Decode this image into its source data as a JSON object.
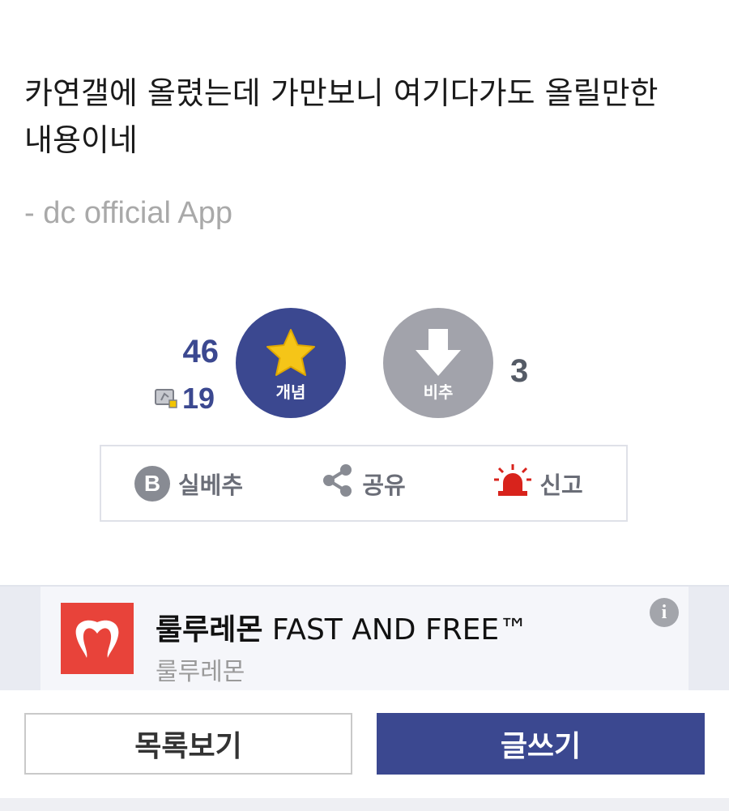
{
  "post": {
    "text_line1": "카연갤에 올렸는데 가만보니 여기다가도 올릴만한",
    "text_line2": "내용이네",
    "signature": "- dc official App"
  },
  "recommend": {
    "up_count": "46",
    "fixed_count": "19",
    "up_label": "개념",
    "down_label": "비추",
    "down_count": "3"
  },
  "actions": {
    "real_best_label": "실베추",
    "real_best_icon_letter": "B",
    "share_label": "공유",
    "report_label": "신고"
  },
  "ad": {
    "brand_bold": "룰루레몬",
    "headline": " FAST AND FREE™",
    "advertiser": "룰루레몬",
    "info_icon": "i"
  },
  "bottom": {
    "list_label": "목록보기",
    "write_label": "글쓰기"
  },
  "colors": {
    "primary": "#3b4890",
    "downvote": "#a2a3ab",
    "report_red": "#d8231c",
    "ad_logo_red": "#e8433a",
    "star_yellow": "#f5c518"
  }
}
